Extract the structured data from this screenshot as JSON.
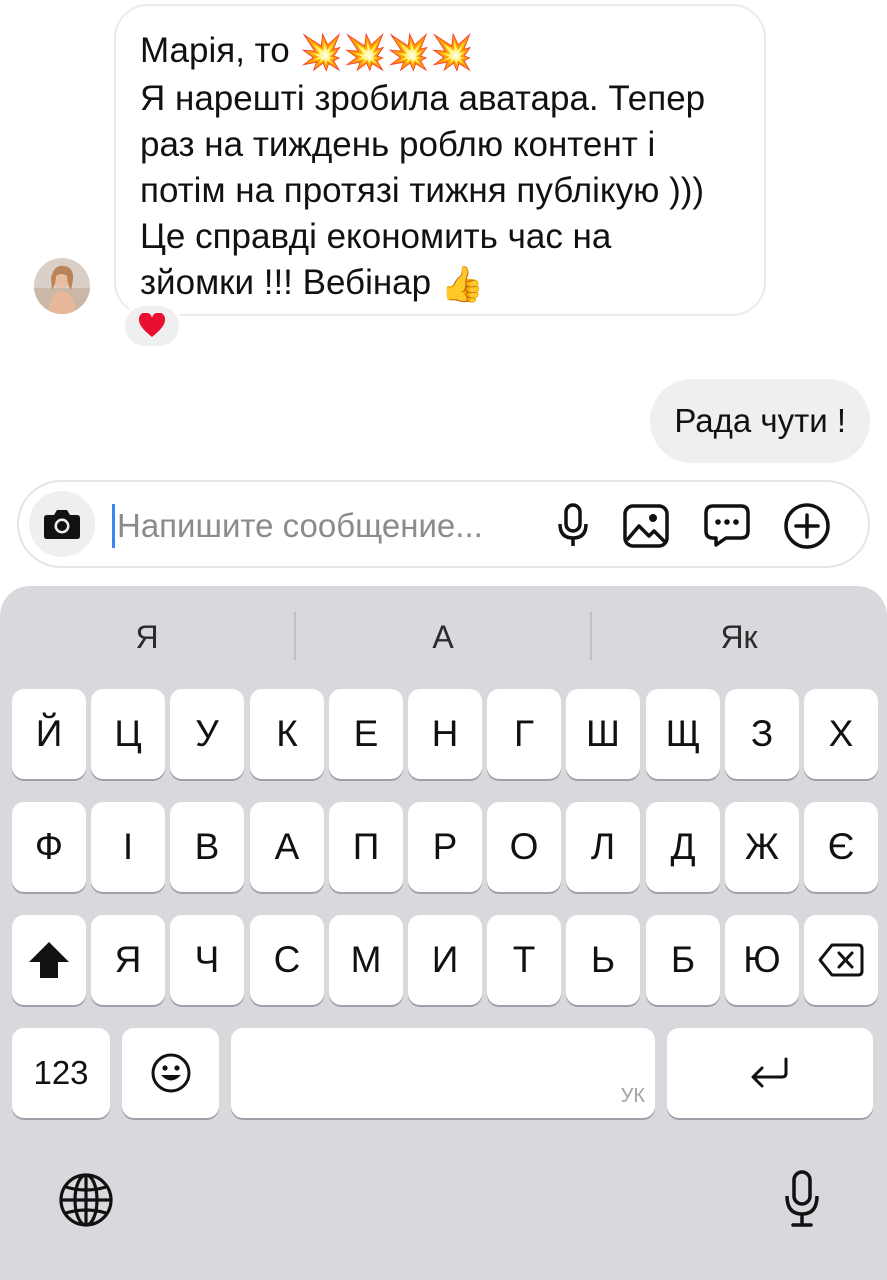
{
  "chat": {
    "incoming": {
      "lines": [
        "Марія, то",
        "Я нарешті  зробила аватара. Тепер",
        "раз на тиждень роблю контент і",
        "потім на протязі тижня публікую )))",
        "Це справді економить час на",
        "зйомки !!! Вебінар"
      ],
      "line1_emojis": [
        "💥",
        "💥",
        "💥",
        "💥"
      ],
      "end_emoji": "👍",
      "reaction": "❤️"
    },
    "outgoing": {
      "text": "Рада чути !"
    }
  },
  "composer": {
    "placeholder": "Напишите сообщение...",
    "value": "",
    "icons": [
      "camera-icon",
      "microphone-icon",
      "image-icon",
      "sticker-icon",
      "plus-circle-icon"
    ]
  },
  "keyboard": {
    "suggestions": [
      "Я",
      "А",
      "Як"
    ],
    "row1": [
      "Й",
      "Ц",
      "У",
      "К",
      "Е",
      "Н",
      "Г",
      "Ш",
      "Щ",
      "З",
      "Х"
    ],
    "row2": [
      "Ф",
      "І",
      "В",
      "А",
      "П",
      "Р",
      "О",
      "Л",
      "Д",
      "Ж",
      "Є"
    ],
    "row3": [
      "Я",
      "Ч",
      "С",
      "М",
      "И",
      "Т",
      "Ь",
      "Б",
      "Ю"
    ],
    "numbers_key": "123",
    "space_language": "УК",
    "icons": [
      "shift-icon",
      "backspace-icon",
      "emoji-icon",
      "return-icon",
      "globe-icon",
      "dictation-icon"
    ]
  },
  "colors": {
    "caret": "#3a86f5",
    "bubble_gray": "#efefef",
    "keyboard_bg": "#d7d9dd"
  }
}
